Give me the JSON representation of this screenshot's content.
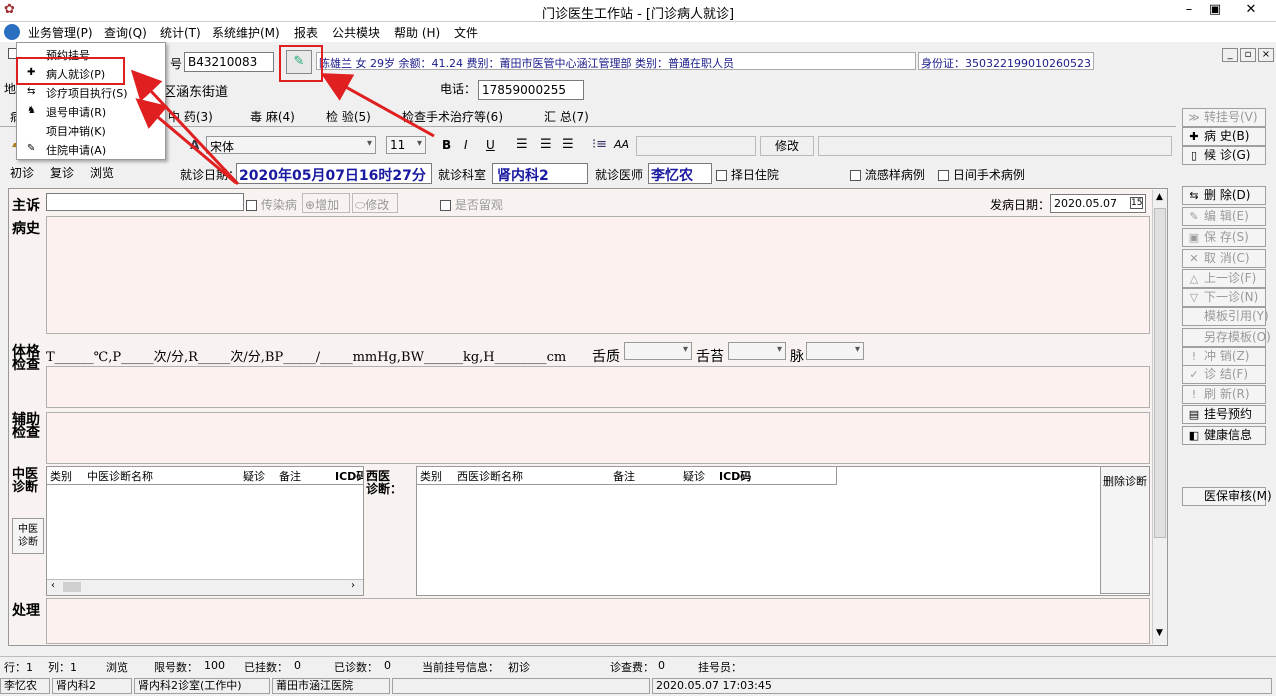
{
  "window": {
    "title": "门诊医生工作站 - [门诊病人就诊]",
    "minimize": "–",
    "restore": "▣",
    "close": "✕"
  },
  "menu": [
    "业务管理(P)",
    "查询(Q)",
    "统计(T)",
    "系统维护(M)",
    "报表",
    "公共模块",
    "帮助 (H)",
    "文件"
  ],
  "dropdown": [
    "预约挂号",
    "病人就诊(P)",
    "诊疗项目执行(S)",
    "退号申请(R)",
    "项目冲销(K)",
    "住院申请(A)"
  ],
  "patient": {
    "reg_label": "号",
    "reg_no": "B43210083",
    "info": "陈雄兰  女  29岁  余额：41.24  费别：莆田市医管中心涵江管理部  类别：普通在职人员",
    "id_label": "身份证：",
    "id": "350322199010260523",
    "addr_label": "地-",
    "address": "区涵东街道",
    "phone_label": "电话：",
    "phone": "17859000255"
  },
  "tabs": [
    "病",
    "中  药(3)",
    "毒  麻(4)",
    "检  验(5)",
    "检查手术治疗等(6)",
    "汇  总(7)"
  ],
  "toolbar": {
    "font": "宋体",
    "size": "11",
    "bold": "B",
    "italic": "I",
    "underline": "U",
    "modify": "修改",
    "aa": "AA"
  },
  "visit": {
    "tabs": [
      "初诊",
      "复诊",
      "浏览"
    ],
    "date_label": "就诊日期：",
    "date": "2020年05月07日16时27分",
    "dept_label": "就诊科室",
    "dept": "肾内科2",
    "doctor_label": "就诊医师",
    "doctor": "李忆农",
    "opt1": "择日住院",
    "opt2": "流感样病例",
    "opt3": "日间手术病例"
  },
  "form": {
    "complaint": "主诉",
    "infect": "传染病",
    "add": "增加",
    "edit": "修改",
    "observe": "是否留观",
    "onset_label": "发病日期：",
    "onset": "2020.05.07",
    "history": "病史",
    "exam_a": "体格",
    "exam_b": "检查",
    "vitals": "T______℃,P_____次/分,R_____次/分,BP_____/_____mmHg,BW______kg,H________cm",
    "tongue": "舌质",
    "coat": "舌苔",
    "pulse": "脉",
    "aux_a": "辅助",
    "aux_b": "检查",
    "tcm_a": "中医",
    "tcm_b": "诊断",
    "tcm_btn_a": "中医",
    "tcm_btn_b": "诊断",
    "west_a": "西医",
    "west_b": "诊断：",
    "del_diag": "删除诊断",
    "treat": "处理"
  },
  "tcm_cols": [
    "类别",
    "中医诊断名称",
    "疑诊",
    "备注",
    "ICD码"
  ],
  "west_cols": [
    "类别",
    "西医诊断名称",
    "备注",
    "疑诊",
    "ICD码"
  ],
  "right_buttons": [
    {
      "label": "转挂号(V)",
      "icon": "≫",
      "enabled": false
    },
    {
      "label": "病   史(B)",
      "icon": "✚",
      "enabled": true
    },
    {
      "label": "候   诊(G)",
      "icon": "▯",
      "enabled": true
    },
    {
      "label": "删   除(D)",
      "icon": "⇆",
      "enabled": true
    },
    {
      "label": "编   辑(E)",
      "icon": "✎",
      "enabled": false
    },
    {
      "label": "保   存(S)",
      "icon": "▣",
      "enabled": false
    },
    {
      "label": "取   消(C)",
      "icon": "✕",
      "enabled": false
    },
    {
      "label": "上一诊(F)",
      "icon": "△",
      "enabled": false
    },
    {
      "label": "下一诊(N)",
      "icon": "▽",
      "enabled": false
    },
    {
      "label": "模板引用(Y)",
      "icon": "",
      "enabled": false
    },
    {
      "label": "另存模板(O)",
      "icon": "",
      "enabled": false
    },
    {
      "label": "冲   销(Z)",
      "icon": "!",
      "enabled": false
    },
    {
      "label": "诊   结(F)",
      "icon": "✓",
      "enabled": false
    },
    {
      "label": "刷   新(R)",
      "icon": "!",
      "enabled": false
    },
    {
      "label": "挂号预约",
      "icon": "▤",
      "enabled": true
    },
    {
      "label": "健康信息",
      "icon": "◧",
      "enabled": true
    },
    {
      "label": "医保审核(M)",
      "icon": "",
      "enabled": true
    }
  ],
  "status": {
    "row": "行：1",
    "col": "列：1",
    "mode": "浏览",
    "limit_label": "限号数：",
    "limit": "100",
    "reg_label": "已挂数：",
    "reg": "0",
    "diag_label": "已诊数：",
    "diag": "0",
    "cur_label": "当前挂号信息：",
    "cur": "初诊",
    "fee_label": "诊查费：",
    "fee": "0",
    "reg_person": "挂号员："
  },
  "footer": [
    "李忆农",
    "肾内科2",
    "肾内科2诊室(工作中)",
    "莆田市涵江医院",
    "2020.05.07 17:03:45"
  ]
}
